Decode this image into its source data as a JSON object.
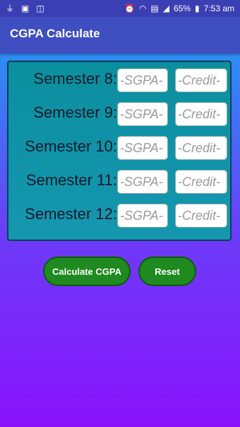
{
  "status_bar": {
    "battery": "65%",
    "time": "7:53 am",
    "left_icons": [
      "usb-icon",
      "sd-card-icon",
      "gallery-icon"
    ],
    "right_icons": [
      "alarm-icon",
      "wifi-icon",
      "sim-icon",
      "signal-icon"
    ]
  },
  "app_bar": {
    "title": "CGPA Calculate"
  },
  "form": {
    "rows": [
      {
        "label": "Semester 8:",
        "sgpa_placeholder": "-SGPA-",
        "credit_placeholder": "-Credit-"
      },
      {
        "label": "Semester 9:",
        "sgpa_placeholder": "-SGPA-",
        "credit_placeholder": "-Credit-"
      },
      {
        "label": "Semester 10:",
        "sgpa_placeholder": "-SGPA-",
        "credit_placeholder": "-Credit-"
      },
      {
        "label": "Semester 11:",
        "sgpa_placeholder": "-SGPA-",
        "credit_placeholder": "-Credit-"
      },
      {
        "label": "Semester 12:",
        "sgpa_placeholder": "-SGPA-",
        "credit_placeholder": "-Credit-"
      }
    ]
  },
  "actions": {
    "calculate_label": "Calculate CGPA",
    "reset_label": "Reset"
  },
  "colors": {
    "app_bar": "#3f4ec0",
    "panel": "#0b8f9e",
    "button": "#1f8a1f"
  }
}
